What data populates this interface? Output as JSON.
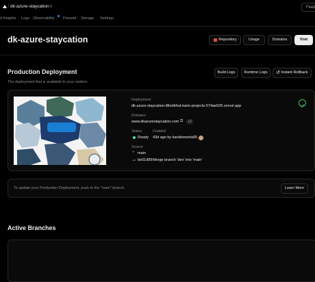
{
  "topbar": {
    "project_name": "dk-azure-staycation",
    "feedback_label": "Feedb"
  },
  "tabs": [
    {
      "label": "d Insights"
    },
    {
      "label": "Logs"
    },
    {
      "label": "Observability"
    },
    {
      "label": "Firewall"
    },
    {
      "label": "Storage"
    },
    {
      "label": "Settings"
    }
  ],
  "header": {
    "title": "dk-azure-staycation",
    "repository_label": "Repository",
    "usage_label": "Usage",
    "domains_label": "Domains",
    "visit_label": "Visit"
  },
  "production": {
    "title": "Production Deployment",
    "description": "The deployment that is available to your visitors.",
    "build_logs_label": "Build Logs",
    "runtime_logs_label": "Runtime Logs",
    "instant_rollback_label": "Instant Rollback",
    "deployment_label": "Deployment",
    "deployment_url": "dk-azure-staycation-8ihotbhut-karis-projects-574ae025.vercel.app",
    "domains_label": "Domains",
    "domain": "www.dkazurestaycation.com",
    "domain_extra": "+3",
    "status_label": "Status",
    "status_value": "Ready",
    "created_label": "Created",
    "created_value": "43d ago by karidemetria95",
    "source_label": "Source",
    "branch": "main",
    "commit_hash": "be01d89",
    "commit_message": "Merge branch 'dev' into 'main'",
    "status_color": "#50e3c2"
  },
  "update_notice": {
    "text": "To update your Production Deployment, push to the \"main\" branch.",
    "learn_more_label": "Learn More"
  },
  "branches": {
    "title": "Active Branches"
  }
}
